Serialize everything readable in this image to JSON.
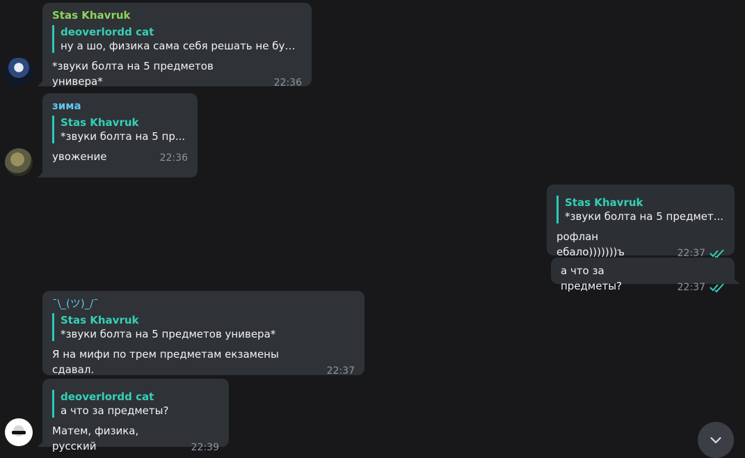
{
  "messages": [
    {
      "sender": "Stas Khavruk",
      "reply_name": "deoverlordd cat",
      "reply_text": "ну а шо, физика сама себя решать не будет",
      "text": "*звуки болта на 5 предметов универа*",
      "time": "22:36"
    },
    {
      "sender": "зима",
      "reply_name": "Stas Khavruk",
      "reply_text": "*звуки болта на 5 пр...",
      "text": "увожение",
      "time": "22:36"
    },
    {
      "reply_name": "Stas Khavruk",
      "reply_text": "*звуки болта на 5 предмет...",
      "text": "рофлан ебало)))))))ъ",
      "time": "22:37"
    },
    {
      "text": "а что за предметы?",
      "time": "22:37"
    },
    {
      "sender_emoji_text": "¯\\_(ツ)_/¯",
      "reply_name": "Stas Khavruk",
      "reply_text": "*звуки болта на 5 предметов универа*",
      "text": "Я на мифи по трем предметам екзамены сдавал.",
      "time": "22:37"
    },
    {
      "reply_name": "deoverlordd cat",
      "reply_text": "а что за предметы?",
      "text": "Матем, физика, русский",
      "time": "22:39"
    }
  ],
  "icons": {
    "double_check": "double-check-icon",
    "scroll_down": "chevron-down-icon"
  },
  "colors": {
    "background": "#18181b",
    "bubble": "#2f3236",
    "reply_accent": "#2bcbba",
    "sender_green": "#8cd55d",
    "sender_blue": "#63c5ef",
    "meta": "#8f969c"
  }
}
